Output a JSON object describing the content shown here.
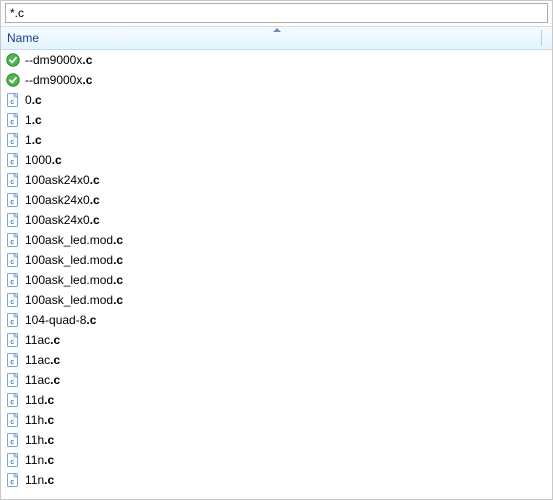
{
  "filter": {
    "value": "*.c"
  },
  "header": {
    "column_label": "Name"
  },
  "files": [
    {
      "icon": "green-check",
      "base": "--dm9000x",
      "ext": ".c"
    },
    {
      "icon": "green-check",
      "base": "--dm9000x",
      "ext": ".c"
    },
    {
      "icon": "c-doc",
      "base": "0",
      "ext": ".c"
    },
    {
      "icon": "c-doc",
      "base": "1",
      "ext": ".c"
    },
    {
      "icon": "c-doc",
      "base": "1",
      "ext": ".c"
    },
    {
      "icon": "c-doc",
      "base": "1000",
      "ext": ".c"
    },
    {
      "icon": "c-doc",
      "base": "100ask24x0",
      "ext": ".c"
    },
    {
      "icon": "c-doc",
      "base": "100ask24x0",
      "ext": ".c"
    },
    {
      "icon": "c-doc",
      "base": "100ask24x0",
      "ext": ".c"
    },
    {
      "icon": "c-doc",
      "base": "100ask_led.mod",
      "ext": ".c"
    },
    {
      "icon": "c-doc",
      "base": "100ask_led.mod",
      "ext": ".c"
    },
    {
      "icon": "c-doc",
      "base": "100ask_led.mod",
      "ext": ".c"
    },
    {
      "icon": "c-doc",
      "base": "100ask_led.mod",
      "ext": ".c"
    },
    {
      "icon": "c-doc",
      "base": "104-quad-8",
      "ext": ".c"
    },
    {
      "icon": "c-doc",
      "base": "11ac",
      "ext": ".c"
    },
    {
      "icon": "c-doc",
      "base": "11ac",
      "ext": ".c"
    },
    {
      "icon": "c-doc",
      "base": "11ac",
      "ext": ".c"
    },
    {
      "icon": "c-doc",
      "base": "11d",
      "ext": ".c"
    },
    {
      "icon": "c-doc",
      "base": "11h",
      "ext": ".c"
    },
    {
      "icon": "c-doc",
      "base": "11h",
      "ext": ".c"
    },
    {
      "icon": "c-doc",
      "base": "11n",
      "ext": ".c"
    },
    {
      "icon": "c-doc",
      "base": "11n",
      "ext": ".c"
    }
  ]
}
